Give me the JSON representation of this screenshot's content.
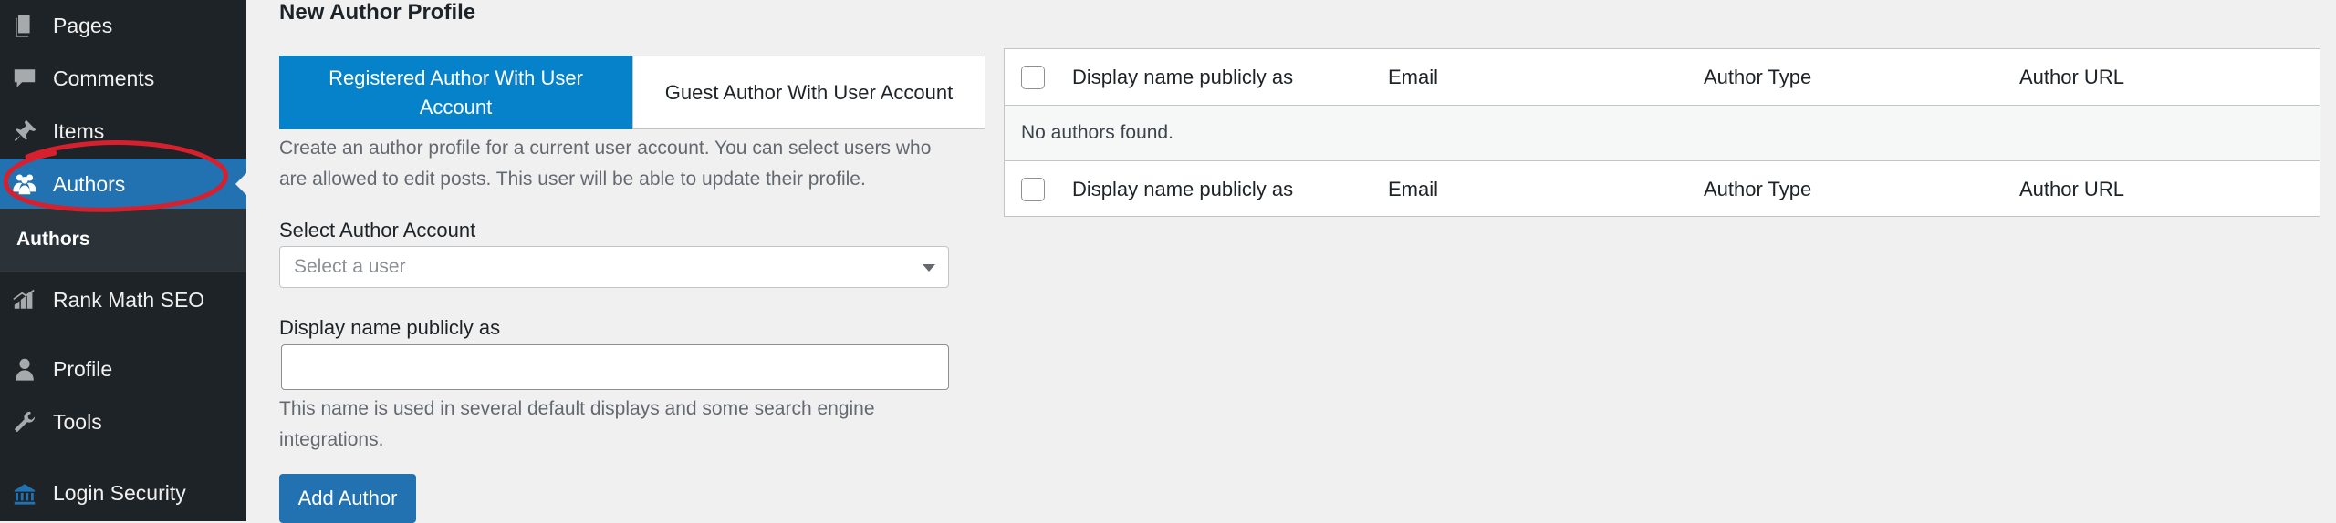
{
  "sidebar": {
    "items": [
      {
        "label": "Pages",
        "icon": "pages-icon"
      },
      {
        "label": "Comments",
        "icon": "comments-icon"
      },
      {
        "label": "Items",
        "icon": "pin-icon"
      },
      {
        "label": "Authors",
        "icon": "authors-icon",
        "active": true
      },
      {
        "label": "Rank Math SEO",
        "icon": "rank-math-icon"
      },
      {
        "label": "Profile",
        "icon": "profile-icon"
      },
      {
        "label": "Tools",
        "icon": "wrench-icon"
      },
      {
        "label": "Login Security",
        "icon": "login-security-icon"
      }
    ],
    "submenu": {
      "label": "Authors"
    }
  },
  "main": {
    "heading": "New Author Profile",
    "tabs": [
      {
        "label": "Registered Author With User Account",
        "selected": true
      },
      {
        "label": "Guest Author With User Account",
        "selected": false
      }
    ],
    "tab_description": "Create an author profile for a current user account. You can select users who are allowed to edit posts. This user will be able to update their profile.",
    "select_author": {
      "label": "Select Author Account",
      "placeholder": "Select a user"
    },
    "display_name": {
      "label": "Display name publicly as",
      "value": "",
      "help": "This name is used in several default displays and some search engine integrations."
    },
    "add_button": "Add Author"
  },
  "table": {
    "columns": [
      "Display name publicly as",
      "Email",
      "Author Type",
      "Author URL"
    ],
    "empty_message": "No authors found."
  },
  "colors": {
    "accent": "#2271b1",
    "tab_selected": "#0582ca",
    "sidebar": "#1d2327",
    "annotation": "#d7202e"
  }
}
